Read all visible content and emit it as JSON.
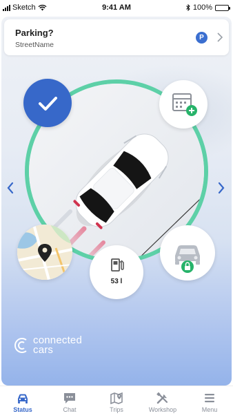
{
  "status_bar": {
    "carrier": "Sketch",
    "time": "9:41 AM",
    "battery": "100%",
    "battery_level": 1.0
  },
  "parking": {
    "title": "Parking?",
    "street": "StreetName",
    "badge": "P"
  },
  "fuel": {
    "level_label": "53 l"
  },
  "brand": {
    "line1": "connected",
    "line2": "cars"
  },
  "colors": {
    "accent": "#3768c9",
    "ring": "#5dd0a7",
    "plus": "#27b36a"
  },
  "icons": [
    "check-icon",
    "calendar-add-icon",
    "map-icon",
    "fuel-icon",
    "car-lock-icon",
    "chevron-left-icon",
    "chevron-right-icon"
  ],
  "tabs": [
    {
      "label": "Status",
      "icon": "car-icon",
      "active": true
    },
    {
      "label": "Chat",
      "icon": "chat-icon",
      "active": false
    },
    {
      "label": "Trips",
      "icon": "trips-map-icon",
      "active": false
    },
    {
      "label": "Workshop",
      "icon": "tools-icon",
      "active": false
    },
    {
      "label": "Menu",
      "icon": "menu-icon",
      "active": false
    }
  ]
}
